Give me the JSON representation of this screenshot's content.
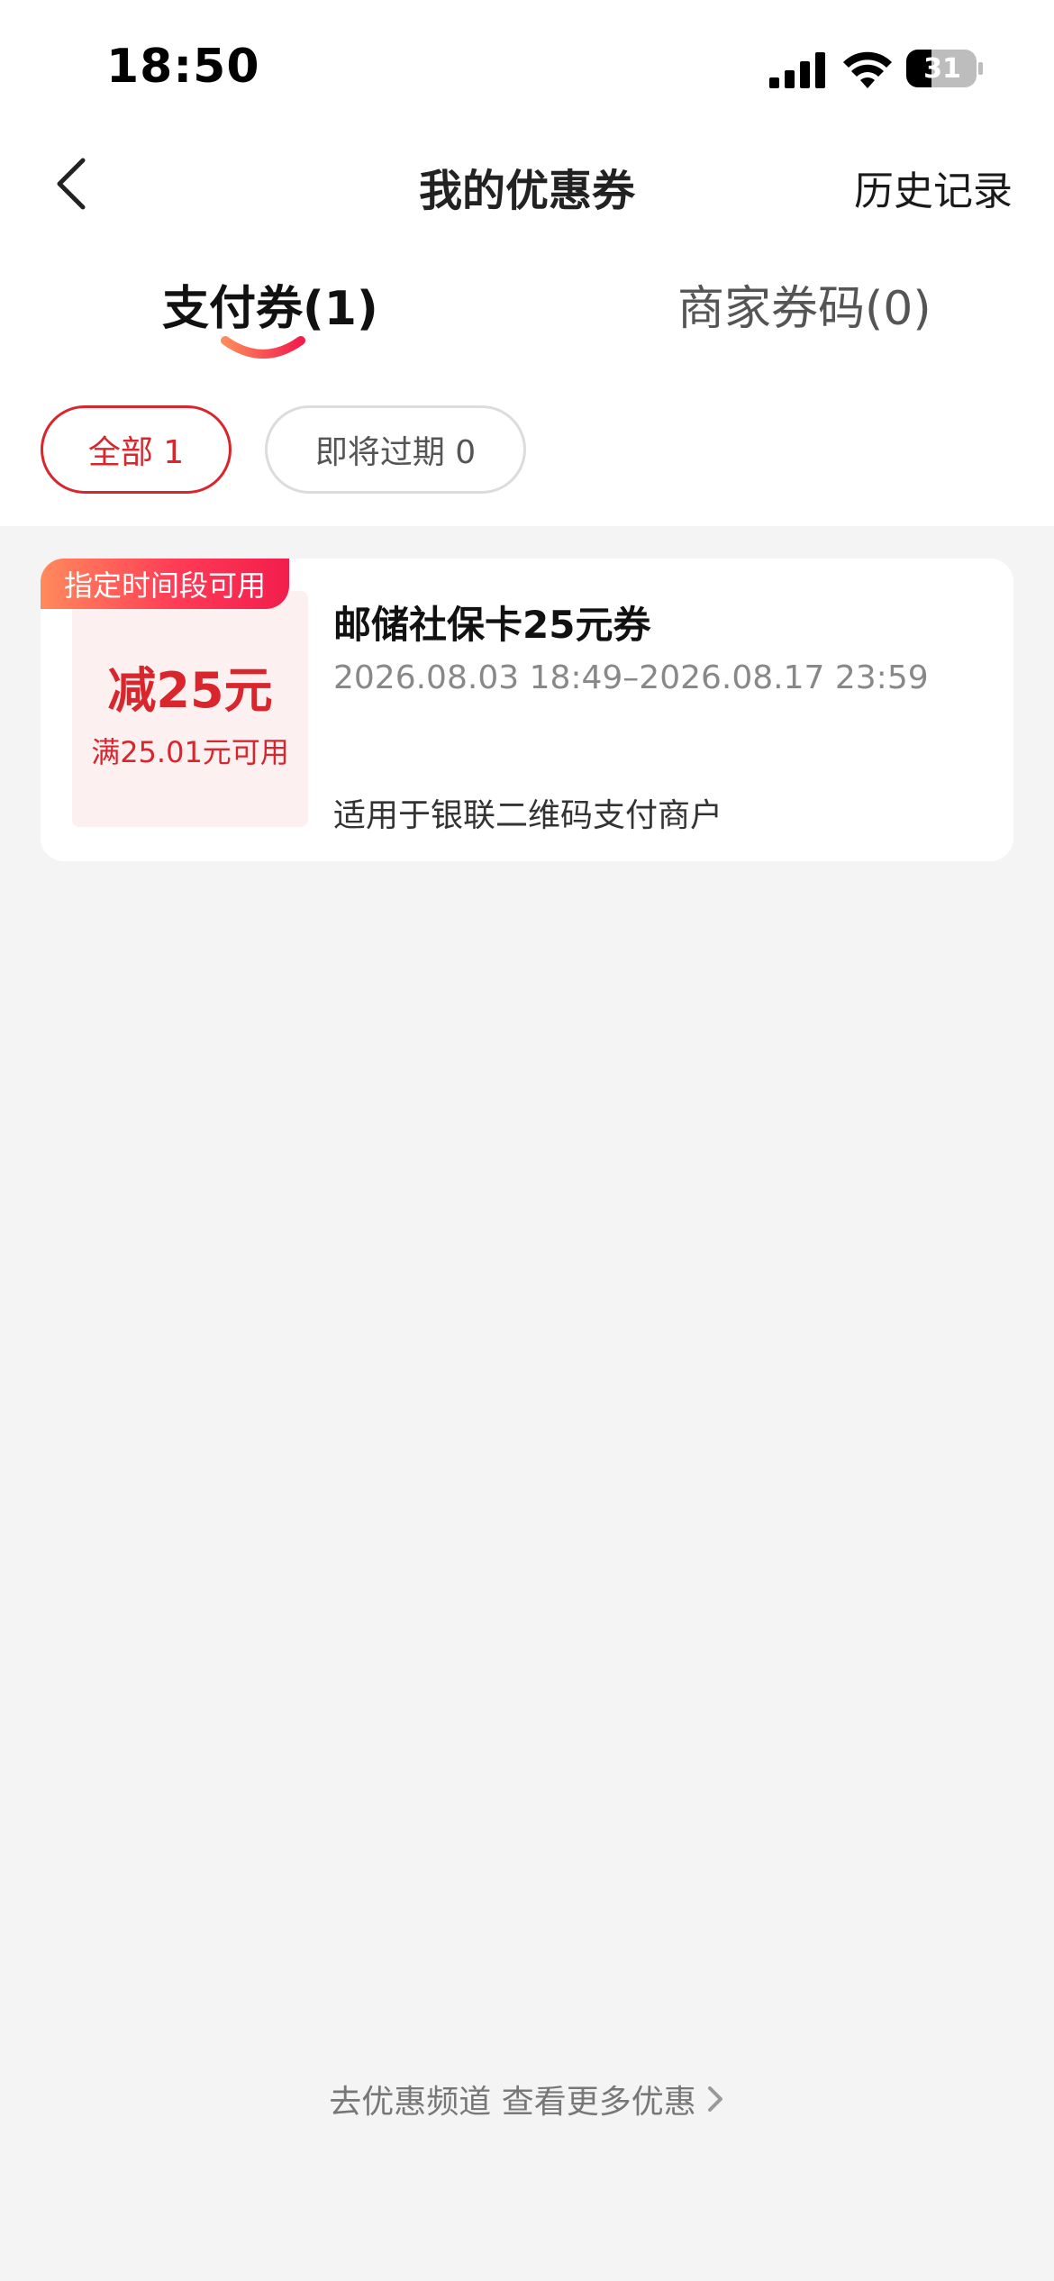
{
  "status_bar": {
    "time": "18:50",
    "battery": "31",
    "icons": [
      "signal-icon",
      "wifi-icon",
      "battery-icon"
    ]
  },
  "nav": {
    "title": "我的优惠券",
    "history_label": "历史记录",
    "back_icon": "chevron-left-icon"
  },
  "tabs": [
    {
      "label": "支付券(1)",
      "active": true
    },
    {
      "label": "商家券码(0)",
      "active": false
    }
  ],
  "filters": [
    {
      "label": "全部 1",
      "active": true
    },
    {
      "label": "即将过期 0",
      "active": false
    }
  ],
  "coupons": [
    {
      "tag": "指定时间段可用",
      "amount": "减25元",
      "condition": "满25.01元可用",
      "name": "邮储社保卡25元券",
      "validity": "2026.08.03 18:49–2026.08.17 23:59",
      "scope": "适用于银联二维码支付商户"
    }
  ],
  "footer": {
    "link_label": "去优惠频道 查看更多优惠",
    "icon": "chevron-right-icon"
  },
  "colors": {
    "accent": "#d9262c",
    "tag_gradient_start": "#ff8a5c",
    "tag_gradient_end": "#f21d4c",
    "background": "#f4f4f4"
  }
}
